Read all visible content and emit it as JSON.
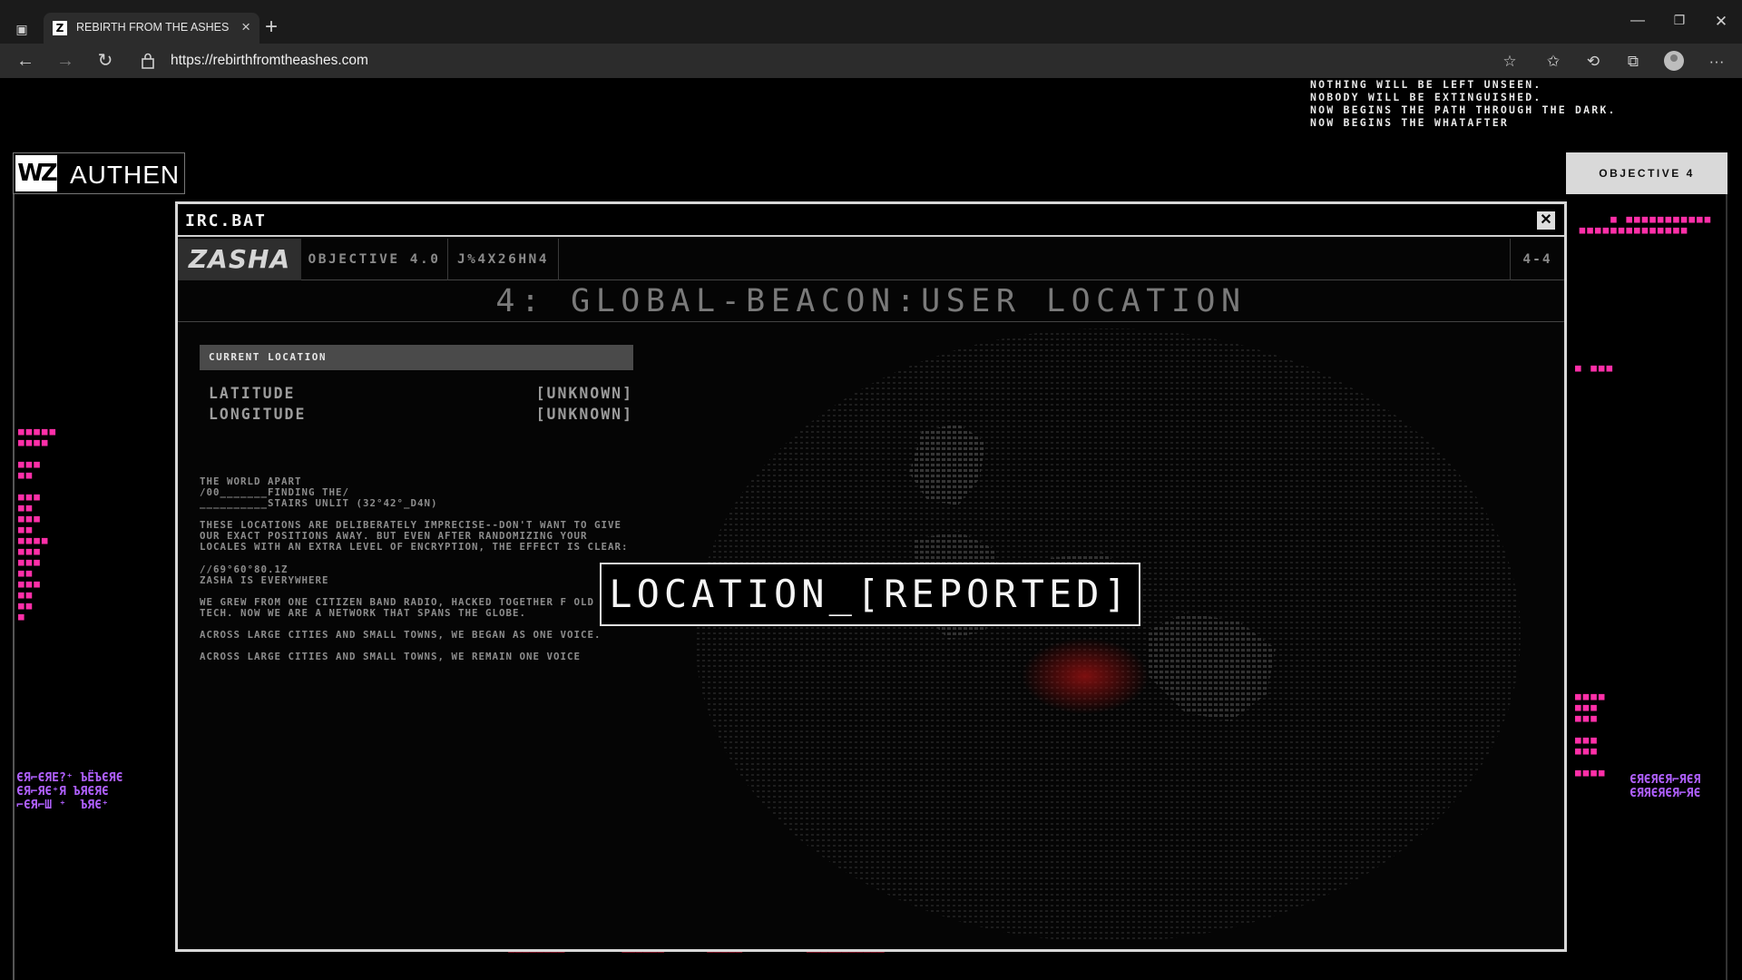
{
  "browser": {
    "tab_title": "REBIRTH FROM THE ASHES // W",
    "tab_favicon": "Z",
    "url": "https://rebirthfromtheashes.com",
    "icons": [
      "tab-actions-icon",
      "close-icon",
      "new-tab-icon",
      "minimize-icon",
      "maximize-icon",
      "window-close-icon",
      "back-icon",
      "forward-icon",
      "reload-icon",
      "lock-icon",
      "add-favorite-icon",
      "favorites-icon",
      "history-icon",
      "collections-icon",
      "profile-icon",
      "more-icon"
    ]
  },
  "page": {
    "top_lines": [
      "NOTHING WILL BE LEFT UNSEEN.",
      "NOBODY WILL BE EXTINGUISHED.",
      "NOW BEGINS THE PATH THROUGH THE DARK.",
      "NOW BEGINS THE WHATAFTER"
    ],
    "wz_logo": "WZ",
    "header_title": "AUTHEN",
    "objective_tab": "OBJECTIVE 4"
  },
  "modal": {
    "title": "IRC.BAT",
    "close_glyph": "✕",
    "logo": "ZASHA",
    "tab_objective": "OBJECTIVE 4.0",
    "tab_code": "J%4X26HN4",
    "page_indicator": "4-4",
    "heading": "4:  GLOBAL-BEACON:USER LOCATION",
    "location": {
      "header": "CURRENT LOCATION",
      "latitude_label": "LATITUDE",
      "latitude_value": "[UNKNOWN]",
      "longitude_label": "LONGITUDE",
      "longitude_value": "[UNKNOWN]"
    },
    "lore": [
      "THE WORLD APART\n/00_______FINDING THE/\n__________STAIRS UNLIT (32°42°_D4N)",
      "THESE LOCATIONS ARE DELIBERATELY IMPRECISE--DON'T WANT TO GIVE OUR EXACT POSITIONS AWAY. BUT EVEN AFTER RANDOMIZING YOUR LOCALES WITH AN EXTRA LEVEL OF ENCRYPTION, THE EFFECT IS CLEAR:",
      "//69°60°80.1Z\nZASHA IS EVERYWHERE",
      "WE GREW FROM ONE CITIZEN BAND RADIO, HACKED TOGETHER F OLD TECH. NOW WE ARE A NETWORK THAT SPANS THE GLOBE.",
      "ACROSS LARGE CITIES AND SMALL TOWNS, WE BEGAN AS ONE VOICE.",
      "ACROSS LARGE CITIES AND SMALL TOWNS, WE REMAIN ONE VOICE"
    ],
    "status": "LOCATION_[REPORTED]"
  },
  "colors": {
    "glitch_pink": "#ff2fa8",
    "glitch_red": "#ff3355",
    "glitch_violet": "#b040ff",
    "beacon_red": "#8a1010"
  }
}
